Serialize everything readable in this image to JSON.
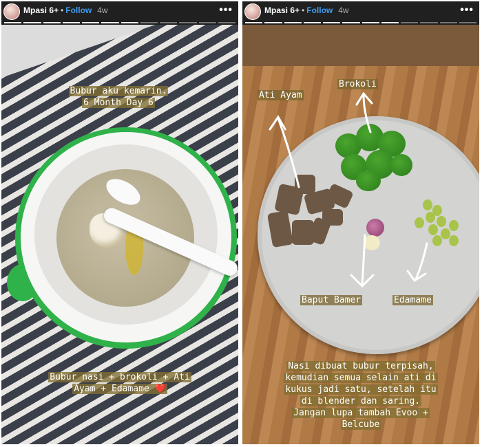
{
  "stories": [
    {
      "user": {
        "name": "Mpasi 6+",
        "follow_label": "Follow",
        "age": "4w"
      },
      "more_label": "•••",
      "caption_top": [
        "Bubur aku kemarin.",
        "6 Month Day 6"
      ],
      "caption_bottom": [
        "Bubur nasi + brokoli + Ati",
        "Ayam + Edamame ❤️"
      ]
    },
    {
      "user": {
        "name": "Mpasi 6+",
        "follow_label": "Follow",
        "age": "4w"
      },
      "more_label": "•••",
      "labels": {
        "ati_ayam": "Ati Ayam",
        "brokoli": "Brokoli",
        "baput_bamer": "Baput Bamer",
        "edamame": "Edamame"
      },
      "caption_bottom": [
        "Nasi dibuat bubur terpisah,",
        "kemudian semua selain ati di",
        "kukus jadi satu, setelah itu",
        "di blender dan saring.",
        "Jangan lupa tambah Evoo +",
        "Belcube"
      ]
    }
  ],
  "colors": {
    "follow": "#3f9cf0",
    "bowl_green": "#2fb24a",
    "caption_bg": "#826e32"
  }
}
